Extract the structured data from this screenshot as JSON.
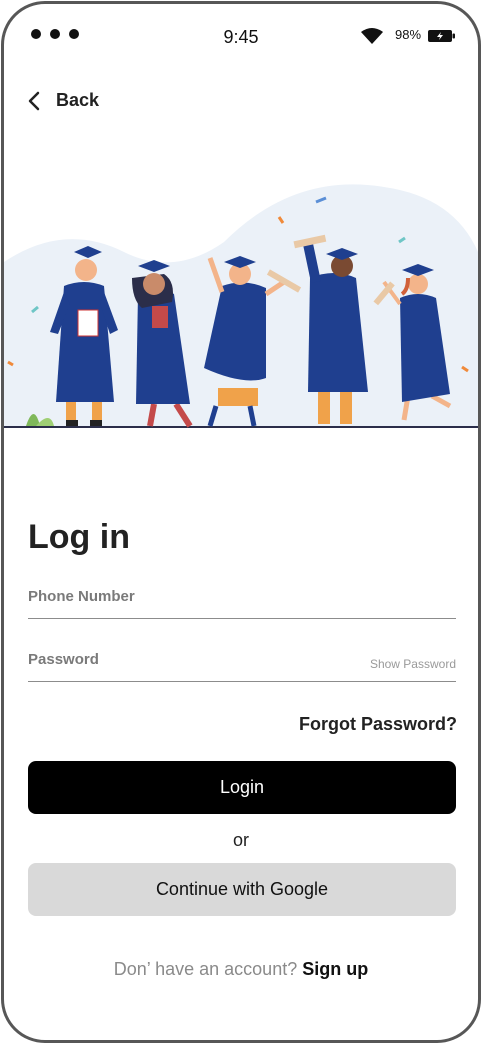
{
  "status_bar": {
    "time": "9:45",
    "battery": "98%",
    "icons": [
      "dots-icon",
      "wifi-icon",
      "battery-icon"
    ]
  },
  "nav": {
    "back_label": "Back",
    "icon": "chevron-left-icon"
  },
  "illustration": {
    "name": "graduates-illustration"
  },
  "form": {
    "title": "Log in",
    "phone_label": "Phone Number",
    "password_label": "Password",
    "show_password": "Show Password",
    "forgot_password": "Forgot Password?",
    "login_button": "Login",
    "or_text": "or",
    "google_button": "Continue with Google"
  },
  "footer": {
    "prompt": "Don’ have an account?",
    "signup_link": "Sign up"
  },
  "colors": {
    "primary_button": "#000000",
    "secondary_button": "#d9d9d9",
    "gown": "#1f3f8f",
    "frame": "#575757"
  }
}
